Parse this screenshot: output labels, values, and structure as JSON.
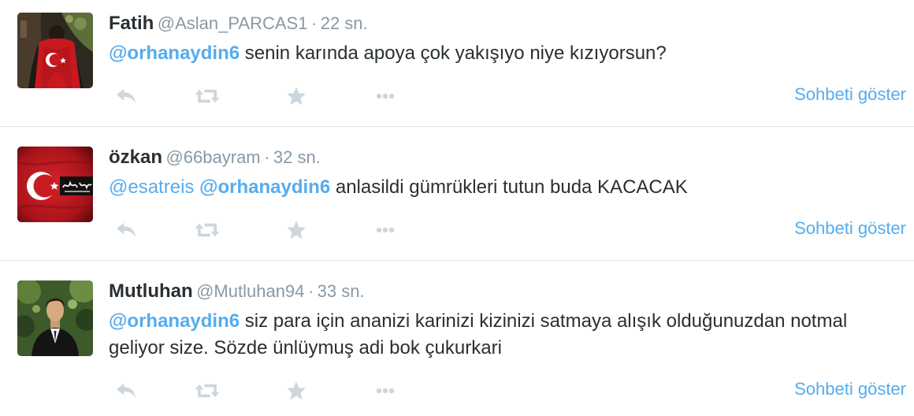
{
  "tweets": [
    {
      "name": "Fatih",
      "handle": "@Aslan_PARCAS1",
      "separator": "·",
      "time": "22 sn.",
      "mentions": [
        "@orhanaydin6"
      ],
      "body": "senin karında apoya çok yakışıyo niye kızıyorsun?",
      "conversation_link": "Sohbeti göster"
    },
    {
      "name": "özkan",
      "handle": "@66bayram",
      "separator": "·",
      "time": "32 sn.",
      "mentions": [
        "@esatreis",
        "@orhanaydin6"
      ],
      "body": "anlasildi gümrükleri tutun buda KACACAK",
      "conversation_link": "Sohbeti göster"
    },
    {
      "name": "Mutluhan",
      "handle": "@Mutluhan94",
      "separator": "·",
      "time": "33 sn.",
      "mentions": [
        "@orhanaydin6"
      ],
      "body": "siz para için ananizi karinizi kizinizi satmaya alışık olduğunuzdan notmal geliyor size. Sözde ünlüymuş adi bok çukurkari",
      "conversation_link": "Sohbeti göster"
    }
  ],
  "action_icons": [
    "reply-icon",
    "retweet-icon",
    "favorite-icon",
    "more-icon"
  ],
  "colors": {
    "link": "#55acee",
    "text": "#292f33",
    "muted": "#8899a6",
    "icon": "#ccd6dd",
    "divider": "#e1e8ed"
  }
}
